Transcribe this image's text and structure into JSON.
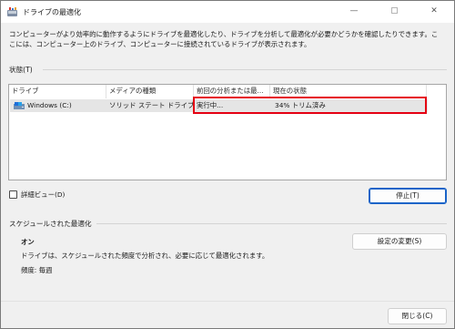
{
  "window": {
    "title": "ドライブの最適化",
    "minimize_glyph": "—",
    "close_glyph": "✕"
  },
  "description": "コンピューターがより効率的に動作するようにドライブを最適化したり、ドライブを分析して最適化が必要かどうかを確認したりできます。ここには、コンピューター上のドライブ、コンピューターに接続されているドライブが表示されます。",
  "status_section": {
    "label": "状態(T)",
    "columns": [
      "ドライブ",
      "メディアの種類",
      "前回の分析または最...",
      "現在の状態"
    ],
    "rows": [
      {
        "drive": "Windows (C:)",
        "media_type": "ソリッド ステート ドライブ",
        "last_run": "実行中...",
        "current_status": "34% トリム済み"
      }
    ]
  },
  "detail_view": {
    "label": "詳細ビュー(D)",
    "checked": false
  },
  "stop_button": {
    "label": "停止(T)"
  },
  "schedule_section": {
    "label": "スケジュールされた最適化",
    "state": "オン",
    "description": "ドライブは、スケジュールされた頻度で分析され、必要に応じて最適化されます。",
    "frequency": "頻度: 毎週",
    "change_settings_label": "設定の変更(S)"
  },
  "close_button": {
    "label": "閉じる(C)"
  },
  "colors": {
    "highlight": "#e50012",
    "focus_border": "#1a64c8",
    "selected_row": "#e5e5e5"
  },
  "icons": {
    "app": "defrag-app-icon",
    "drive": "drive-icon"
  }
}
